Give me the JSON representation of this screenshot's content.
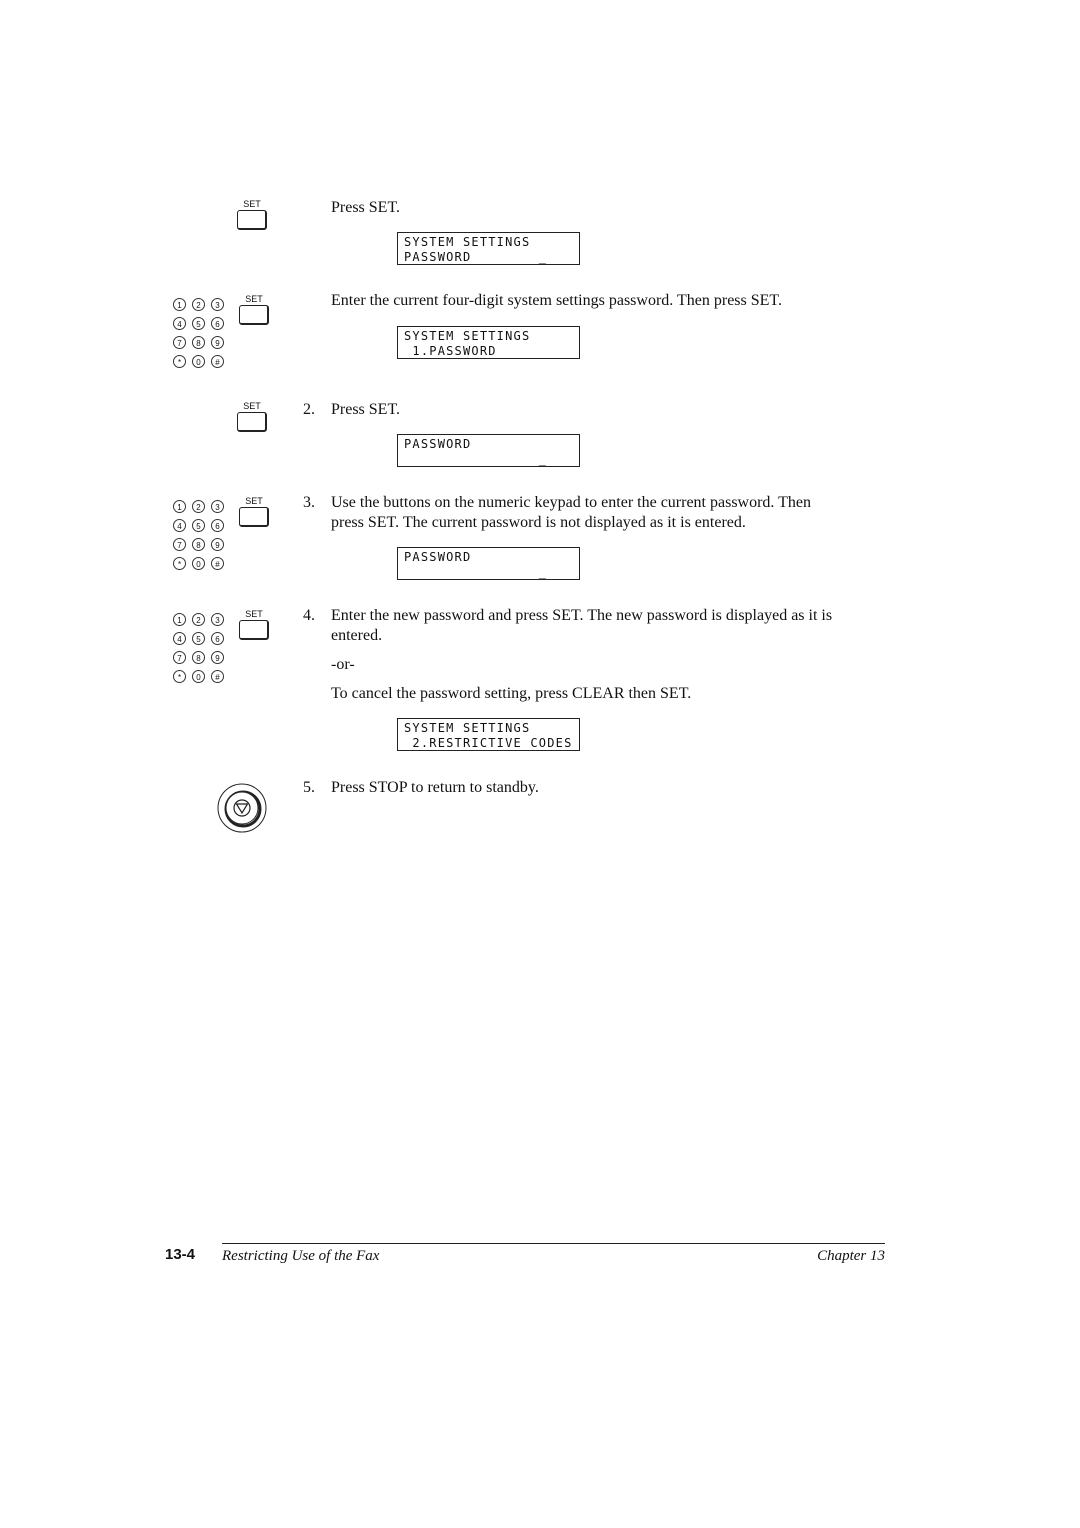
{
  "set_label": "SET",
  "keypad_keys": [
    "1",
    "2",
    "3",
    "4",
    "5",
    "6",
    "7",
    "8",
    "9",
    "*",
    "0",
    "#"
  ],
  "intro": {
    "press_set": "Press SET.",
    "enter_password": "Enter the current four-digit system settings password. Then press SET."
  },
  "lcd": [
    {
      "line1": "SYSTEM SETTINGS",
      "line2": "PASSWORD        _"
    },
    {
      "line1": "SYSTEM SETTINGS",
      "line2": " 1.PASSWORD"
    },
    {
      "line1": "PASSWORD",
      "line2": "                _"
    },
    {
      "line1": "PASSWORD",
      "line2": "                _"
    },
    {
      "line1": "SYSTEM SETTINGS",
      "line2": " 2.RESTRICTIVE CODES"
    }
  ],
  "steps": [
    {
      "num": "2.",
      "text": "Press SET."
    },
    {
      "num": "3.",
      "line1": "Use the buttons on the numeric keypad to enter the current password. Then",
      "line2": "press SET. The current password is not displayed as it is entered."
    },
    {
      "num": "4.",
      "line1": "Enter the new password and press SET. The new password is displayed as it is",
      "line2": "entered.",
      "or": "-or-",
      "cancel": "To cancel the password setting, press CLEAR then SET."
    },
    {
      "num": "5.",
      "text": "Press STOP to return to standby."
    }
  ],
  "footer": {
    "page": "13-4",
    "title": "Restricting Use of the Fax",
    "chapter": "Chapter 13"
  }
}
